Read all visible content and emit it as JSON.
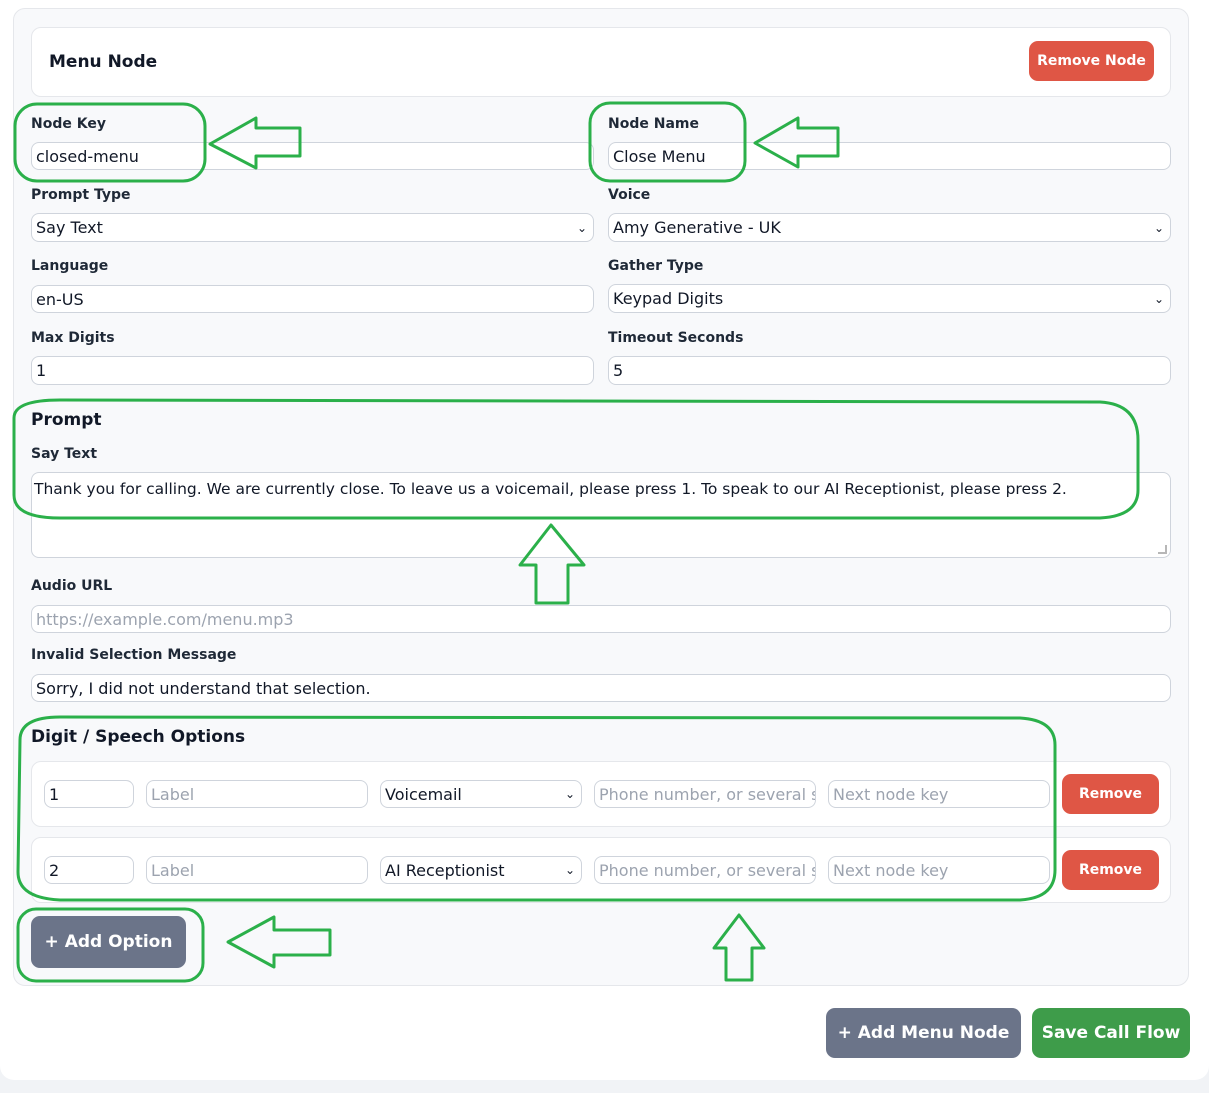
{
  "node": {
    "title": "Menu Node",
    "remove_node_label": "Remove Node"
  },
  "fields": {
    "node_key": {
      "label": "Node Key",
      "value": "closed-menu"
    },
    "node_name": {
      "label": "Node Name",
      "value": "Close Menu"
    },
    "prompt_type": {
      "label": "Prompt Type",
      "value": "Say Text"
    },
    "voice": {
      "label": "Voice",
      "value": "Amy Generative - UK"
    },
    "language": {
      "label": "Language",
      "value": "en-US"
    },
    "gather_type": {
      "label": "Gather Type",
      "value": "Keypad Digits"
    },
    "max_digits": {
      "label": "Max Digits",
      "value": "1"
    },
    "timeout_seconds": {
      "label": "Timeout Seconds",
      "value": "5"
    }
  },
  "prompt": {
    "section_title": "Prompt",
    "say_text_label": "Say Text",
    "say_text_value": "Thank you for calling. We are currently close. To leave us a voicemail, please press 1. To speak to our AI Receptionist, please press 2.",
    "audio_url_label": "Audio URL",
    "audio_url_placeholder": "https://example.com/menu.mp3",
    "invalid_label": "Invalid Selection Message",
    "invalid_value": "Sorry, I did not understand that selection."
  },
  "options": {
    "section_title": "Digit / Speech Options",
    "label_placeholder": "Label",
    "phone_placeholder": "Phone number, or several se",
    "next_placeholder": "Next node key",
    "remove_label": "Remove",
    "rows": [
      {
        "digit": "1",
        "action": "Voicemail"
      },
      {
        "digit": "2",
        "action": "AI Receptionist"
      }
    ],
    "add_option_label": "+ Add Option"
  },
  "footer": {
    "add_menu_node_label": "+ Add Menu Node",
    "save_label": "Save Call Flow"
  },
  "colors": {
    "annotation": "#2bb04a",
    "danger": "#df5645",
    "neutral": "#6b7489",
    "success": "#3e9c4a"
  },
  "icons": {
    "select_chevron": "chevron-down-icon",
    "annotation_arrow": "arrow-icon"
  }
}
